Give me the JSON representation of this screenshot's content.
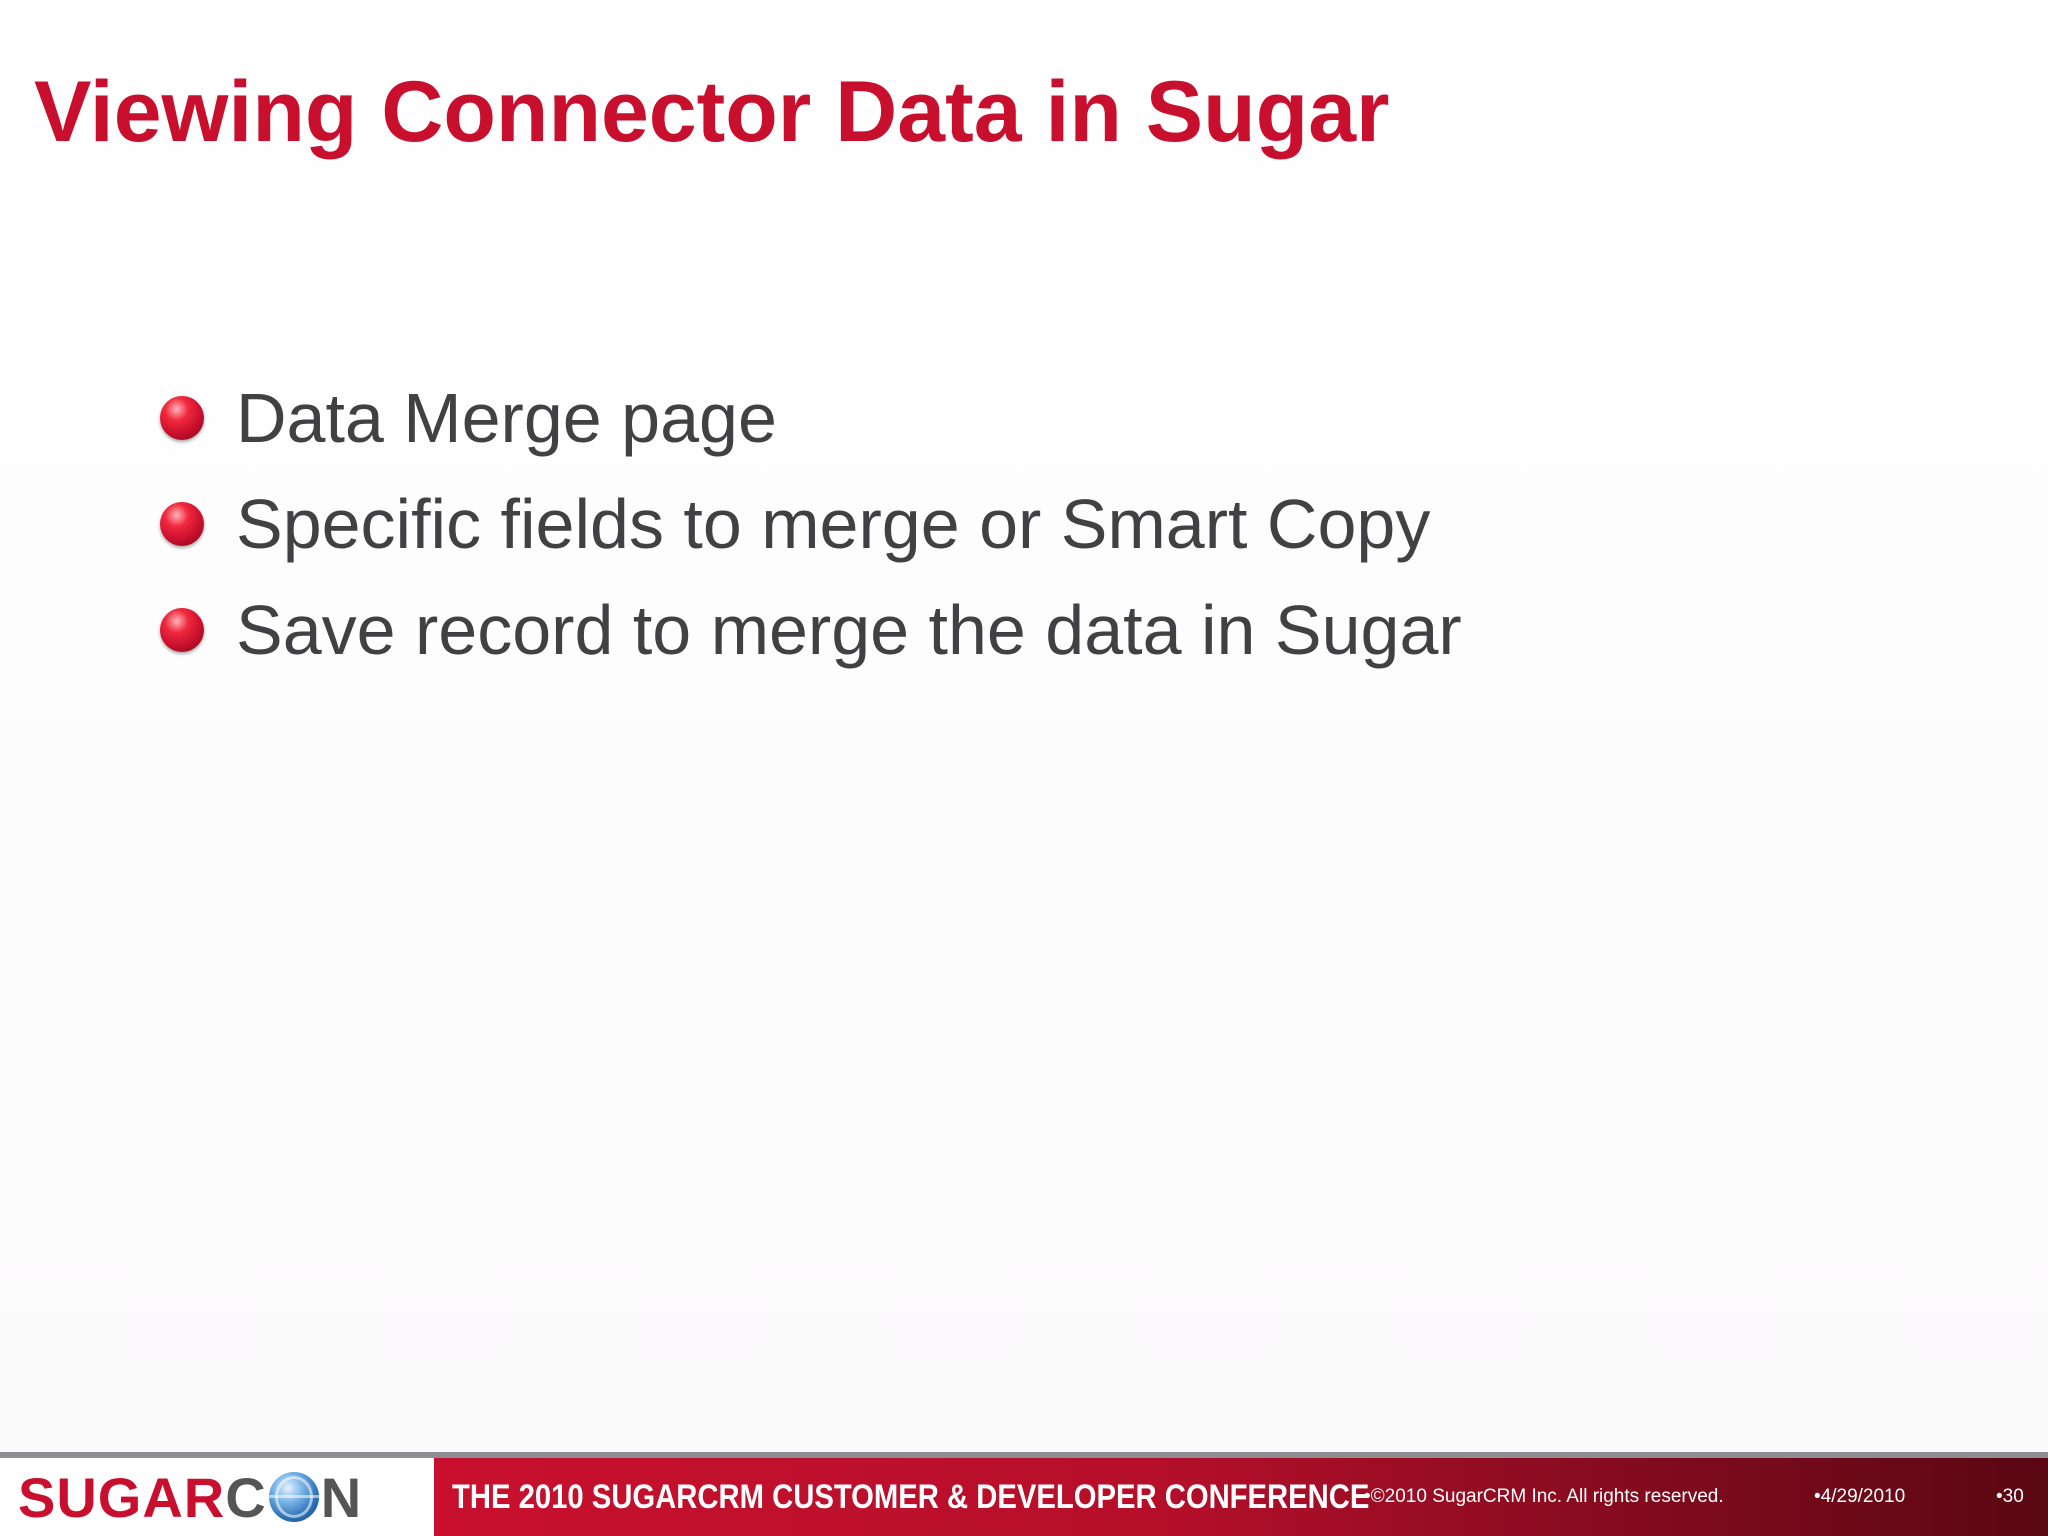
{
  "slide": {
    "title": "Viewing Connector Data in Sugar",
    "bullets": [
      "Data Merge page",
      "Specific fields to merge or Smart Copy",
      "Save record to merge the data in Sugar"
    ]
  },
  "footer": {
    "logo": {
      "sugar": "SUGAR",
      "c": "C",
      "n": "N"
    },
    "conference_title": "THE 2010 SUGARCRM CUSTOMER & DEVELOPER CONFERENCE",
    "copyright": "•©2010 SugarCRM Inc. All rights reserved.",
    "date": "•4/29/2010",
    "page_number": "•30"
  },
  "colors": {
    "accent": "#c8102e",
    "body_text": "#414042"
  },
  "icons": {
    "bullet": "red-sphere-bullet-icon",
    "logo_o": "globe-icon"
  }
}
